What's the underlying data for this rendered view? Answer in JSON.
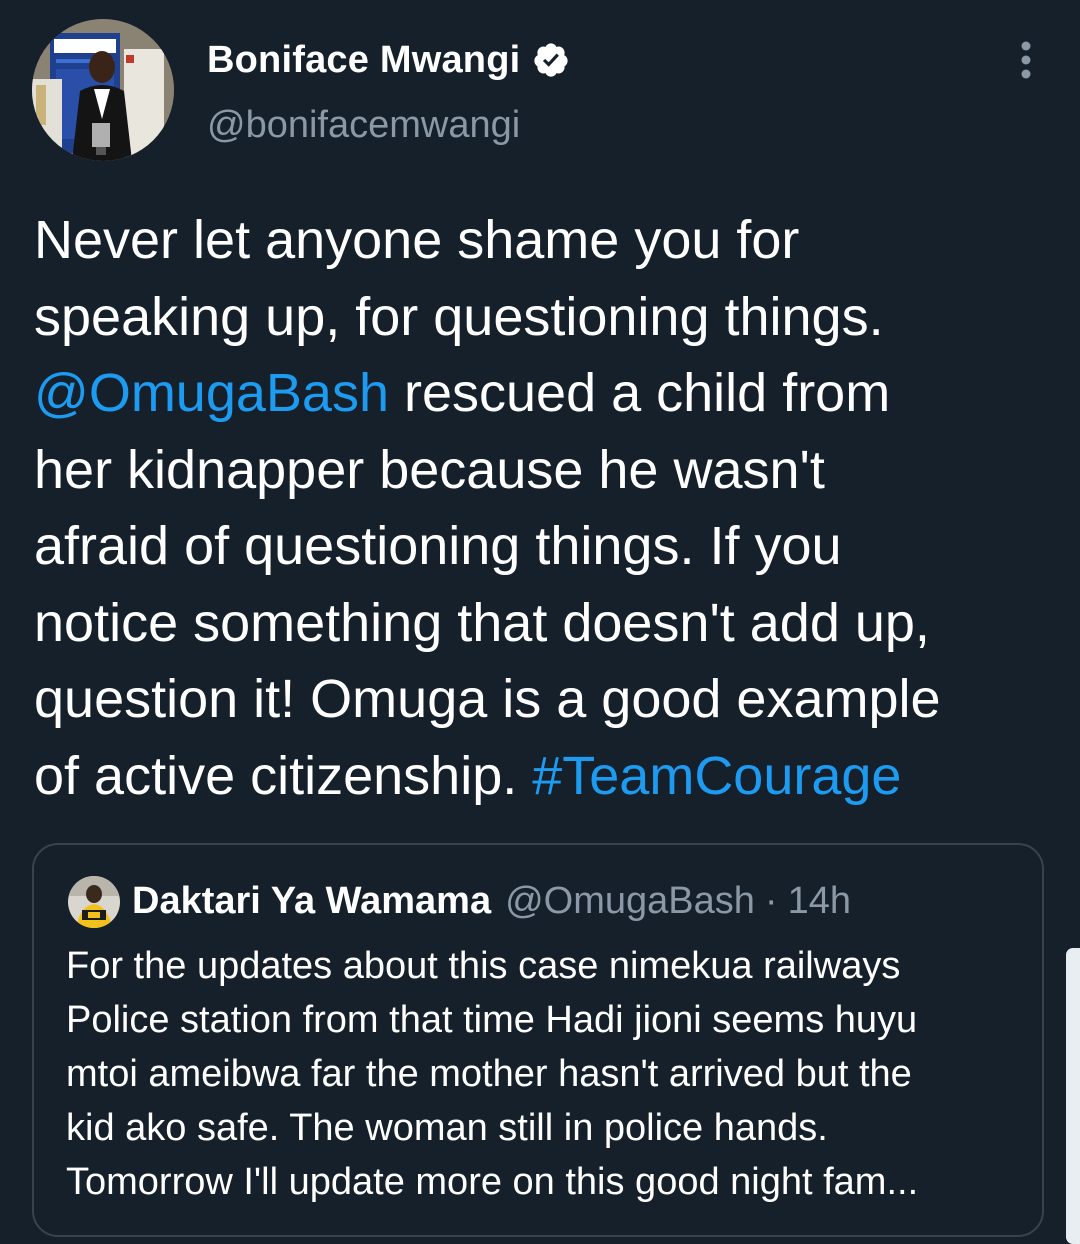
{
  "tweet": {
    "author": {
      "display_name": "Boniface Mwangi",
      "handle": "@bonifacemwangi",
      "verified": true
    },
    "text_lines": [
      [
        {
          "t": "Never let anyone shame you for",
          "link": false
        }
      ],
      [
        {
          "t": "speaking up, for questioning things.",
          "link": false
        }
      ],
      [
        {
          "t": "@OmugaBash",
          "link": true
        },
        {
          "t": " rescued a child from",
          "link": false
        }
      ],
      [
        {
          "t": "her kidnapper because he wasn't",
          "link": false
        }
      ],
      [
        {
          "t": "afraid of  questioning things. If you",
          "link": false
        }
      ],
      [
        {
          "t": "notice something that doesn't add up,",
          "link": false
        }
      ],
      [
        {
          "t": "question it! Omuga is a good example",
          "link": false
        }
      ],
      [
        {
          "t": "of active citizenship. ",
          "link": false
        },
        {
          "t": "#TeamCourage",
          "link": true
        }
      ]
    ]
  },
  "quoted_tweet": {
    "display_name": "Daktari Ya Wamama",
    "handle": "@OmugaBash",
    "separator": "·",
    "time": "14h",
    "text_lines": [
      "For the updates about this case nimekua railways",
      "Police station from that time Hadi jioni seems huyu",
      "mtoi ameibwa far the mother hasn't arrived but the",
      "kid ako safe. The woman still in police hands.",
      "Tomorrow I'll update more on this good night fam..."
    ]
  },
  "icons": {
    "verified": "verified-badge-icon",
    "more": "more-vertical-icon"
  },
  "colors": {
    "background": "#15202b",
    "text": "#ffffff",
    "secondary_text": "#8b98a5",
    "link": "#1d9bf0",
    "border": "#38444d"
  }
}
